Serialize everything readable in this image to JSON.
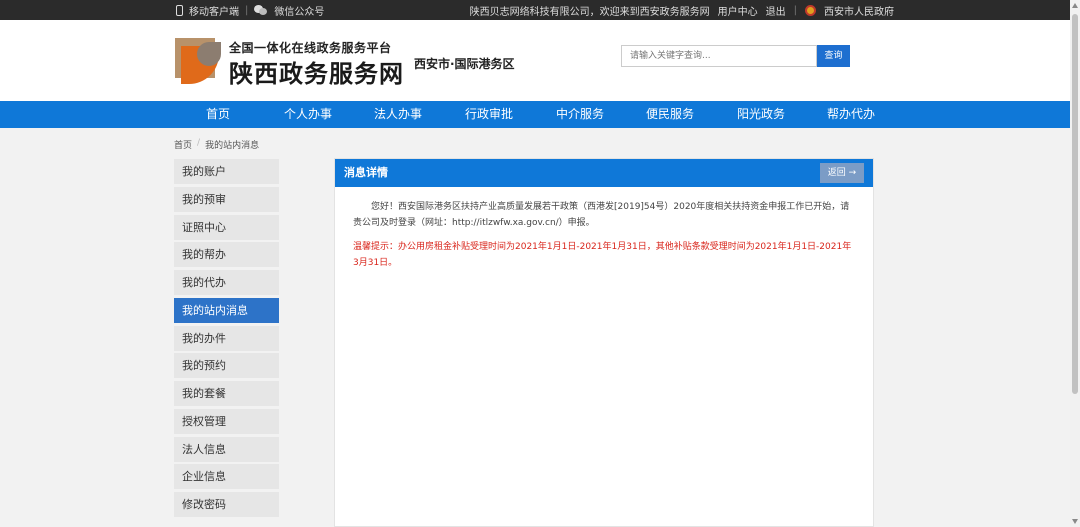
{
  "topbar": {
    "mobile": "移动客户端",
    "wechat": "微信公众号",
    "welcome": "陕西贝志网络科技有限公司，欢迎来到西安政务服务网",
    "user_center": "用户中心",
    "logout": "退出",
    "gov": "西安市人民政府"
  },
  "header": {
    "logo_sub": "全国一体化在线政务服务平台",
    "logo_main": "陕西政务服务网",
    "region": "西安市·国际港务区",
    "search_placeholder": "请输入关键字查询...",
    "search_button": "查询"
  },
  "nav": [
    {
      "label": "首页"
    },
    {
      "label": "个人办事"
    },
    {
      "label": "法人办事"
    },
    {
      "label": "行政审批"
    },
    {
      "label": "中介服务"
    },
    {
      "label": "便民服务"
    },
    {
      "label": "阳光政务"
    },
    {
      "label": "帮办代办"
    }
  ],
  "breadcrumb": {
    "home": "首页",
    "sep": "/",
    "current": "我的站内消息"
  },
  "sidebar": [
    {
      "label": "我的账户"
    },
    {
      "label": "我的预审"
    },
    {
      "label": "证照中心"
    },
    {
      "label": "我的帮办"
    },
    {
      "label": "我的代办"
    },
    {
      "label": "我的站内消息",
      "active": true
    },
    {
      "label": "我的办件"
    },
    {
      "label": "我的预约"
    },
    {
      "label": "我的套餐"
    },
    {
      "label": "授权管理"
    },
    {
      "label": "法人信息"
    },
    {
      "label": "企业信息"
    },
    {
      "label": "修改密码"
    }
  ],
  "panel": {
    "title": "消息详情",
    "back": "返回 →",
    "message": "您好！西安国际港务区扶持产业高质量发展若干政策（西港发[2019]54号）2020年度相关扶持资金申报工作已开始，请贵公司及时登录（网址：http://itlzwfw.xa.gov.cn/）申报。",
    "tip": "温馨提示：办公用房租金补贴受理时间为2021年1月1日-2021年1月31日，其他补贴条款受理时间为2021年1月1日-2021年3月31日。"
  }
}
